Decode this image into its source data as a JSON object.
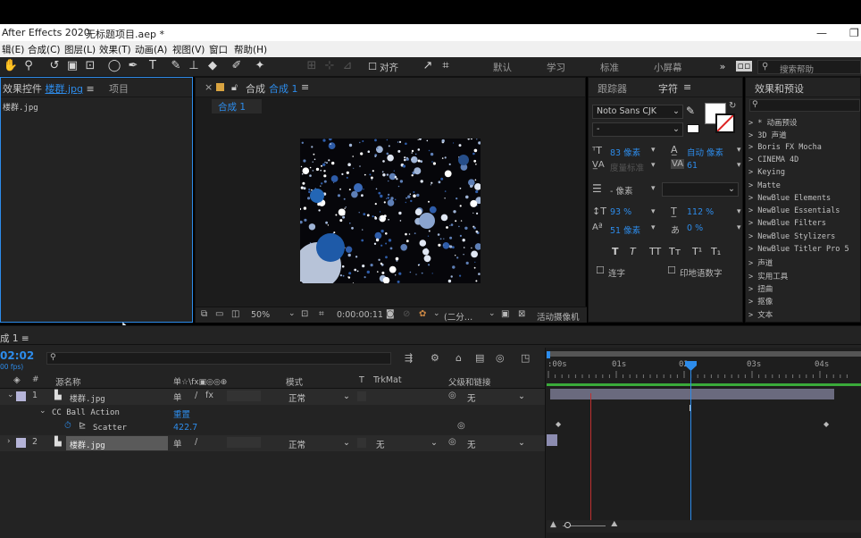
{
  "titlebar": {
    "app": "After Effects 2020",
    "doc": "无标题项目.aep *"
  },
  "menu": [
    "辑(E)",
    "合成(C)",
    "图层(L)",
    "效果(T)",
    "动画(A)",
    "视图(V)",
    "窗口",
    "帮助(H)"
  ],
  "toolbar": {
    "snap_label": "对齐",
    "workspaces": [
      "默认",
      "学习",
      "标准",
      "小屏幕"
    ],
    "search_placeholder": "搜索帮助"
  },
  "effects_panel": {
    "tab_effects": "效果控件",
    "tab_effects_file": "楼群.jpg",
    "tab_project": "项目",
    "file_label": "楼群.jpg"
  },
  "comp_panel": {
    "title": "合成",
    "comp_name": "合成 1",
    "sub_tab": "合成 1",
    "zoom": "50%",
    "timecode": "0:00:00:11",
    "resolution": "(二分…",
    "camera": "活动摄像机"
  },
  "char_panel": {
    "tab_tracker": "跟踪器",
    "tab_character": "字符",
    "font": "Noto Sans CJK",
    "style": "-",
    "size": "83 像素",
    "leading": "自动 像素",
    "kerning": "度量标准",
    "tracking": "61",
    "stroke": "- 像素",
    "vscale": "93 %",
    "hscale": "112 %",
    "baseline": "51 像素",
    "tsume": "0 %",
    "faux_labels": [
      "T",
      "T",
      "TT",
      "Tт",
      "T¹",
      "T₁"
    ],
    "ligatures": "连字",
    "hindi": "印地语数字"
  },
  "presets_panel": {
    "title": "效果和预设",
    "items": [
      "* 动画预设",
      "3D 声道",
      "Boris FX Mocha",
      "CINEMA 4D",
      "Keying",
      "Matte",
      "NewBlue Elements",
      "NewBlue Essentials",
      "NewBlue Filters",
      "NewBlue Stylizers",
      "NewBlue Titler Pro 5",
      "声道",
      "实用工具",
      "扭曲",
      "抠像",
      "文本"
    ]
  },
  "timeline": {
    "tab": "成 1",
    "timecode": "02:02",
    "fps": "00 fps)",
    "columns": {
      "layer_name": "源名称",
      "switches": "单☆\\fx▣◎◎⊕",
      "mode": "模式",
      "t": "T",
      "trkmat": "TrkMat",
      "parent": "父级和链接"
    },
    "layers": [
      {
        "num": "1",
        "name": "楼群.jpg",
        "mode": "正常",
        "trkmat": "",
        "parent": "无"
      },
      {
        "num": "2",
        "name": "楼群.jpg",
        "mode": "正常",
        "trkmat": "无",
        "parent": "无"
      }
    ],
    "effect_name": "CC Ball Action",
    "effect_reset": "重置",
    "prop_name": "Scatter",
    "prop_value": "422.7",
    "ruler": [
      ":00s",
      "01s",
      "02s",
      "03s",
      "04s"
    ]
  },
  "colors": {
    "accent": "#2d8ceb",
    "panel": "#232323",
    "layer_bar": "#6a6a7e"
  }
}
